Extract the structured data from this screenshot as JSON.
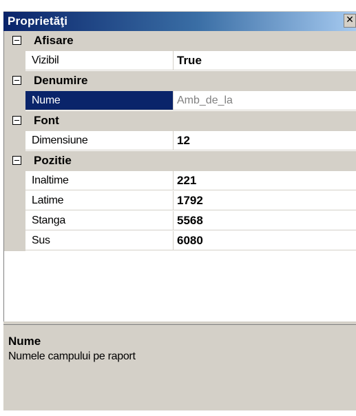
{
  "window": {
    "title": "Proprietăţi",
    "close_glyph": "✕",
    "close_icon": "close-icon"
  },
  "grid": {
    "categories": [
      {
        "label": "Afisare",
        "expanded": true,
        "properties": [
          {
            "name": "Vizibil",
            "value": "True"
          }
        ]
      },
      {
        "label": "Denumire",
        "expanded": true,
        "properties": [
          {
            "name": "Nume",
            "value": "Amb_de_la"
          }
        ]
      },
      {
        "label": "Font",
        "expanded": true,
        "properties": [
          {
            "name": "Dimensiune",
            "value": "12"
          }
        ]
      },
      {
        "label": "Pozitie",
        "expanded": true,
        "properties": [
          {
            "name": "Inaltime",
            "value": "221"
          },
          {
            "name": "Latime",
            "value": "1792"
          },
          {
            "name": "Stanga",
            "value": "5568"
          },
          {
            "name": "Sus",
            "value": "6080"
          }
        ]
      }
    ],
    "selected_property": "Nume"
  },
  "help": {
    "title": "Nume",
    "description": "Numele campului pe raport"
  },
  "colors": {
    "title_start": "#0a246a",
    "title_end": "#a6caf0",
    "selection": "#0a246a",
    "face": "#d4d0c8",
    "disabled_text": "#808080"
  }
}
